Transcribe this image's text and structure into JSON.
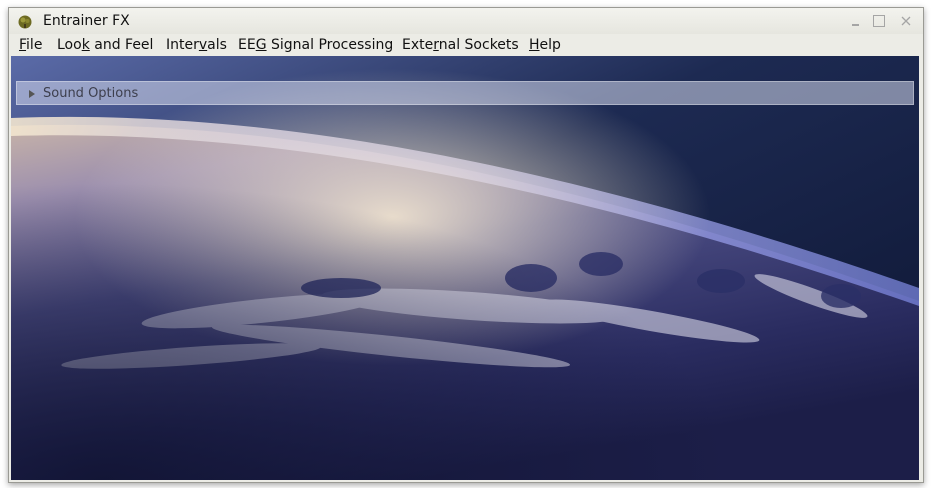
{
  "window": {
    "title": "Entrainer FX",
    "app_icon": "tree-icon",
    "controls": {
      "minimize_icon": "minimize-icon",
      "maximize_icon": "maximize-icon",
      "close_icon": "close-icon"
    }
  },
  "menubar": {
    "items": [
      {
        "pre": "",
        "mn": "F",
        "post": "ile"
      },
      {
        "pre": "Loo",
        "mn": "k",
        "post": " and Feel"
      },
      {
        "pre": "Inter",
        "mn": "v",
        "post": "als"
      },
      {
        "pre": "EE",
        "mn": "G",
        "post": " Signal Processing"
      },
      {
        "pre": "Exte",
        "mn": "r",
        "post": "nal Sockets"
      },
      {
        "pre": "",
        "mn": "H",
        "post": "elp"
      }
    ]
  },
  "content": {
    "background": "earth-from-space-image",
    "sound_panel": {
      "label": "Sound Options",
      "icon": "expand-triangle-icon",
      "expanded": false
    }
  },
  "colors": {
    "window_bg": "#ecece6",
    "space": "#101a33",
    "atmosphere": "#8c9ae8",
    "horizon_glow": "#f0dcb8"
  }
}
